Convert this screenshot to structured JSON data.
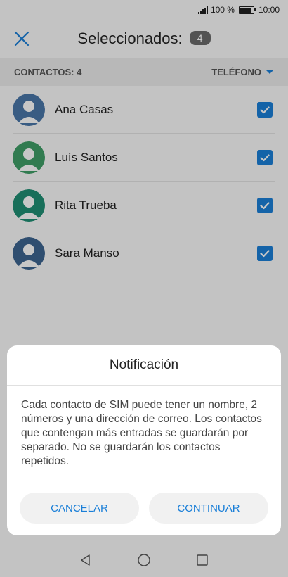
{
  "status_bar": {
    "battery_text": "100 %",
    "time": "10:00"
  },
  "toolbar": {
    "title": "Seleccionados:",
    "count": "4"
  },
  "section": {
    "contacts_label": "CONTACTOS: 4",
    "filter_label": "TELÉFONO"
  },
  "contacts": [
    {
      "name": "Ana Casas",
      "avatar_color": "#4a76a8"
    },
    {
      "name": "Luís Santos",
      "avatar_color": "#3f9e67"
    },
    {
      "name": "Rita Trueba",
      "avatar_color": "#1f8f74"
    },
    {
      "name": "Sara Manso",
      "avatar_color": "#3d6590"
    }
  ],
  "dialog": {
    "title": "Notificación",
    "message": "Cada contacto de SIM puede tener un nombre, 2 números y una dirección de correo. Los contactos que contengan más entradas se guardarán por separado. No se guardarán los contactos repetidos.",
    "cancel_label": "CANCELAR",
    "continue_label": "CONTINUAR"
  },
  "colors": {
    "accent": "#1a7fd8"
  }
}
